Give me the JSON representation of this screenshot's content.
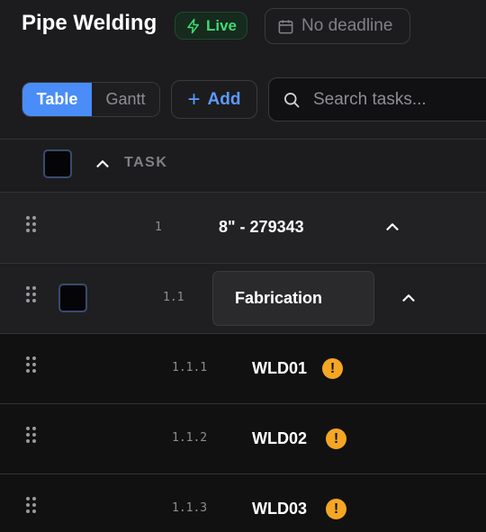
{
  "header": {
    "title": "Pipe Welding",
    "status": "Live",
    "deadline": "No deadline"
  },
  "toolbar": {
    "views": [
      "Table",
      "Gantt"
    ],
    "active_view": "Table",
    "add_label": "Add",
    "search_placeholder": "Search tasks..."
  },
  "table": {
    "column_header": "TASK",
    "rows": [
      {
        "number": "1",
        "name": "8\" - 279343",
        "level": 0,
        "expanded": true
      },
      {
        "number": "1.1",
        "name": "Fabrication",
        "level": 1,
        "expanded": true
      },
      {
        "number": "1.1.1",
        "name": "WLD01",
        "level": 2,
        "warning": "!"
      },
      {
        "number": "1.1.2",
        "name": "WLD02",
        "level": 2,
        "warning": "!"
      },
      {
        "number": "1.1.3",
        "name": "WLD03",
        "level": 2,
        "warning": "!"
      }
    ]
  },
  "colors": {
    "accent": "#4a8df8",
    "live_green": "#3ddc6f",
    "warning": "#f5a623"
  },
  "icons": {
    "live": "lightning-icon",
    "deadline": "calendar-icon",
    "add": "plus-icon",
    "search": "search-icon",
    "expand": "chevron-up-icon",
    "drag": "drag-handle-icon",
    "warning": "warning-icon"
  }
}
